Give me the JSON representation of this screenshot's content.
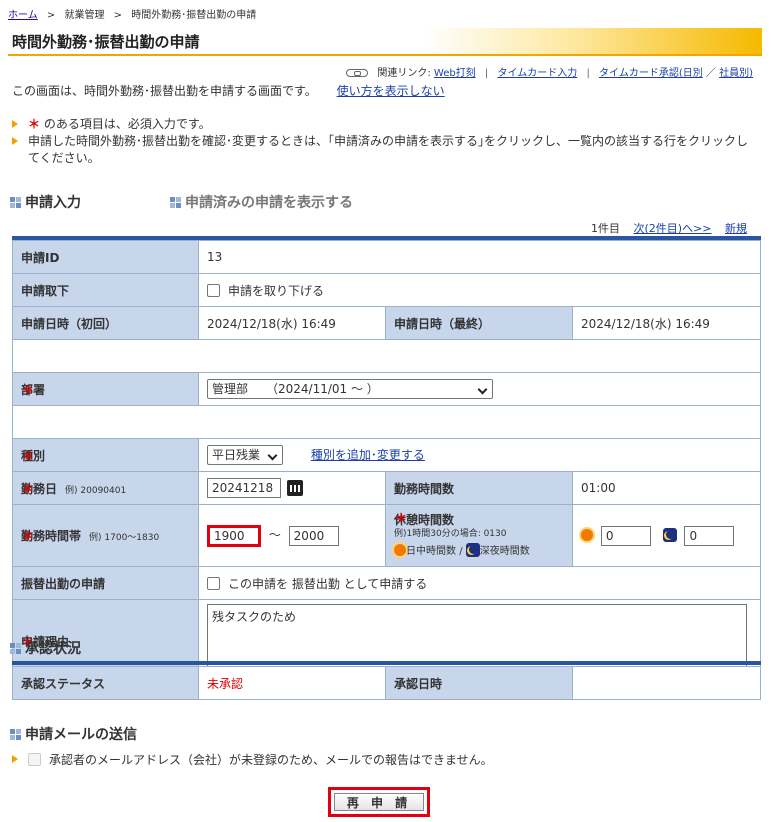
{
  "breadcrumb": {
    "home": "ホーム",
    "sep": ">",
    "level2": "就業管理",
    "current": "時間外勤務･振替出勤の申請"
  },
  "page_title": "時間外勤務･振替出勤の申請",
  "related": {
    "label": "関連リンク:",
    "links": [
      "Web打刻",
      "タイムカード入力",
      "タイムカード承認(日別",
      "社員別)"
    ],
    "slash": "／"
  },
  "intro": {
    "text": "この画面は、時間外勤務･振替出勤を申請する画面です。",
    "howto_link": "使い方を表示しない"
  },
  "notes": {
    "required_star": "＊",
    "required_text": "のある項目は、必須入力です。",
    "confirm_text": "申請した時間外勤務･振替出勤を確認･変更するときは、｢申請済みの申請を表示する｣をクリックし、一覧内の該当する行をクリックしてください。"
  },
  "sections": {
    "apply_input": "申請入力",
    "show_applied": "申請済みの申請を表示する",
    "approval_status": "承認状況",
    "mail_send": "申請メールの送信"
  },
  "pager": {
    "count": "1件目",
    "next": "次(2件目)へ>>",
    "new": "新規"
  },
  "form": {
    "application_id": {
      "label": "申請ID",
      "value": "13"
    },
    "withdraw": {
      "label": "申請取下",
      "checkbox_label": "申請を取り下げる"
    },
    "apply_datetime_first": {
      "label": "申請日時（初回）",
      "value": "2024/12/18(水) 16:49"
    },
    "apply_datetime_last": {
      "label": "申請日時（最終）",
      "value": "2024/12/18(水) 16:49"
    },
    "department": {
      "label": "部署",
      "value": "管理部　　（2024/11/01 ～ ）"
    },
    "type": {
      "label": "種別",
      "value": "平日残業",
      "link": "種別を追加･変更する"
    },
    "work_date": {
      "label": "勤務日",
      "example": "例) 20090401",
      "value": "20241218"
    },
    "work_hours": {
      "label": "勤務時間数",
      "value": "01:00"
    },
    "work_time_range": {
      "label": "勤務時間帯",
      "example": "例) 1700～1830",
      "from": "1900",
      "tilde": "～",
      "to": "2000"
    },
    "break_hours": {
      "label": "休憩時間数",
      "example": "例)1時間30分の場合: 0130",
      "day_label": "日中時間数",
      "slash": "/",
      "night_label": "深夜時間数",
      "day_value": "0",
      "night_value": "0"
    },
    "substitute": {
      "label": "振替出勤の申請",
      "checkbox_label": "この申請を 振替出勤 として申請する"
    },
    "reason": {
      "label": "申請理由",
      "value": "残タスクのため"
    }
  },
  "approval": {
    "status_label": "承認ステータス",
    "status_value": "未承認",
    "date_label": "承認日時",
    "date_value": ""
  },
  "mail": {
    "note": "承認者のメールアドレス（会社）が未登録のため、メールでの報告はできません。"
  },
  "resubmit_label": "再 申 請",
  "colors": {
    "accent_orange": "#f6b900",
    "header_blue": "#2a55a3",
    "label_bg": "#c7d6eb",
    "required_red": "#dd0000",
    "highlight_red": "#e00010"
  }
}
